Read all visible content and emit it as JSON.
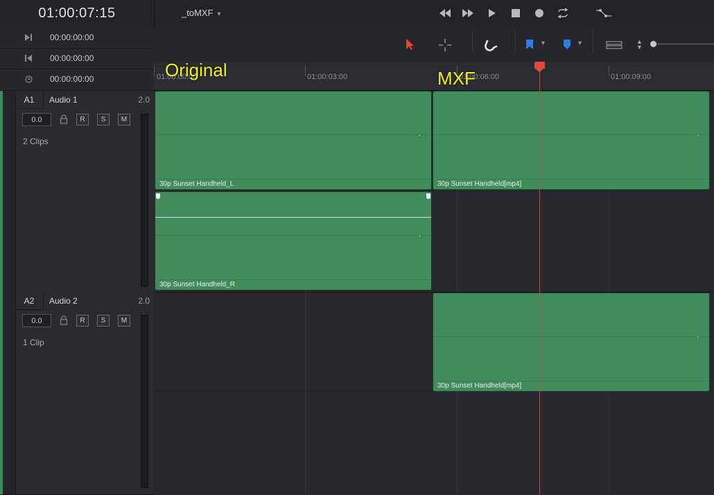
{
  "header": {
    "timecode": "01:00:07:15",
    "timeline_name": "_toMXF"
  },
  "tc_rows": [
    {
      "icon": "in-point-icon",
      "value": "00:00:00:00"
    },
    {
      "icon": "out-point-icon",
      "value": "00:00:00:00"
    },
    {
      "icon": "duration-clock-icon",
      "value": "00:00:00:00"
    }
  ],
  "ruler": {
    "labels": [
      "01:00:00:00",
      "01:00:03:00",
      "01:00:06:00",
      "01:00:09:00"
    ]
  },
  "annotations": {
    "original": "Original",
    "mxf": "MXF"
  },
  "tracks": [
    {
      "id": "A1",
      "name": "Audio 1",
      "channels": "2.0",
      "volume": "0.0",
      "r": "R",
      "s": "S",
      "m": "M",
      "clip_count": "2 Clips"
    },
    {
      "id": "A2",
      "name": "Audio 2",
      "channels": "2.0",
      "volume": "0.0",
      "r": "R",
      "s": "S",
      "m": "M",
      "clip_count": "1 Clip"
    }
  ],
  "clips": [
    {
      "name": "30p Sunset Handheld_L"
    },
    {
      "name": "30p Sunset Handheld[mp4]"
    },
    {
      "name": "30p Sunset Handheld_R"
    },
    {
      "name": "30p Sunset Handheld[mp4]"
    }
  ],
  "colors": {
    "clip": "#418c5c",
    "playhead": "#e04a3d",
    "annotation": "#f2f21a",
    "select_tool": "#e0463a",
    "flag": "#2e7ae6"
  }
}
